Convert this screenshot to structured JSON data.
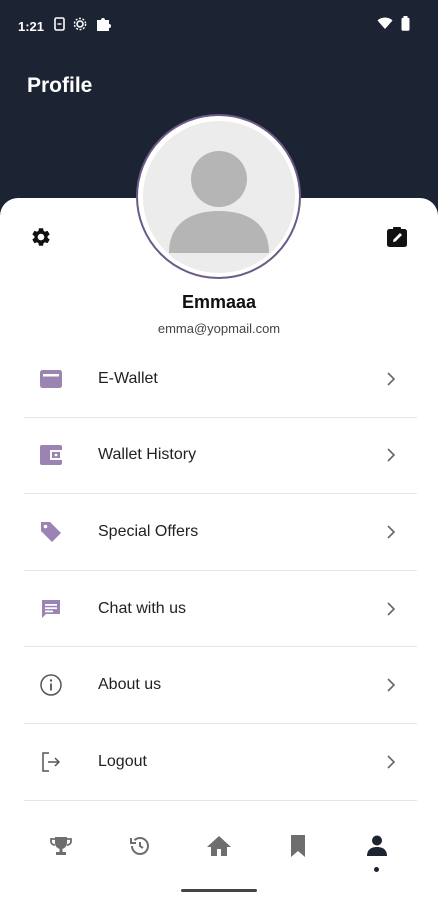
{
  "status_bar": {
    "time": "1:21",
    "left_icons": [
      "sim-icon",
      "settings-small-icon",
      "puzzle-icon"
    ],
    "right_icons": [
      "wifi-icon",
      "battery-icon"
    ]
  },
  "header": {
    "title": "Profile"
  },
  "profile": {
    "name": "Emmaaa",
    "email": "emma@yopmail.com",
    "avatar_icon": "default-avatar-icon"
  },
  "actions": {
    "settings_icon": "gear-icon",
    "edit_icon": "edit-icon"
  },
  "menu": {
    "items": [
      {
        "label": "E-Wallet",
        "icon": "wallet-card-icon"
      },
      {
        "label": "Wallet History",
        "icon": "wallet-icon"
      },
      {
        "label": "Special Offers",
        "icon": "tag-icon"
      },
      {
        "label": "Chat with us",
        "icon": "chat-icon"
      },
      {
        "label": "About us",
        "icon": "info-icon"
      },
      {
        "label": "Logout",
        "icon": "logout-icon"
      }
    ]
  },
  "bottom_nav": {
    "items": [
      "trophy-icon",
      "history-icon",
      "home-icon",
      "bookmark-icon",
      "person-icon"
    ],
    "active": "person-icon"
  },
  "colors": {
    "header_bg": "#1c2333",
    "accent": "#9b84b4",
    "nav_icon": "#6e6e6e"
  }
}
